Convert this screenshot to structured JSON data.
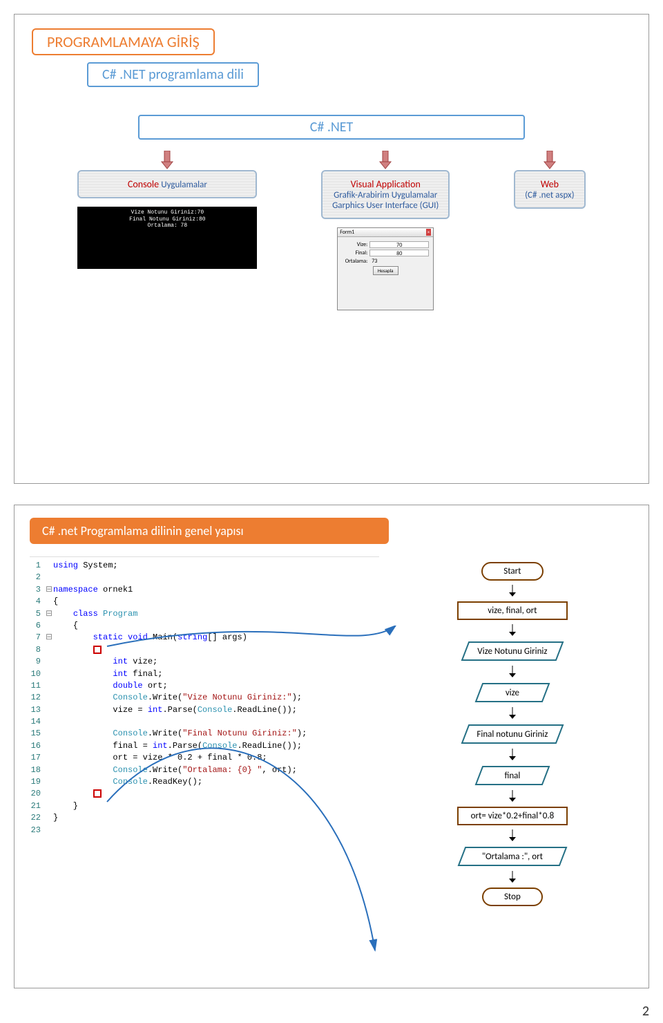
{
  "slide1": {
    "title": "PROGRAMLAMAYA GİRİŞ",
    "subtitle": "C# .NET    programlama dili",
    "center": "C# .NET",
    "boxes": {
      "console": {
        "line1": "Console",
        "line2": "Uygulamalar"
      },
      "visual": {
        "line1": "Visual   Application",
        "line2a": "Grafik-Arabirim Uygulamalar",
        "line2b": "Garphics User Interface (GUI)"
      },
      "web": {
        "line1": "Web",
        "line2": "(C# .net  aspx)"
      }
    },
    "consoleThumb": "Vize Notunu Giriniz:70\nFinal Notunu Giriniz:80\nOrtalama: 78",
    "formThumb": {
      "title": "Form1",
      "vize": "Vize:",
      "vizeVal": "70",
      "final": "Final:",
      "finalVal": "80",
      "ort": "Ortalama:",
      "ortVal": "73",
      "btn": "Hesapla"
    }
  },
  "slide2": {
    "title": "C# .net Programlama dilinin genel yapısı",
    "code": [
      {
        "n": "1",
        "g": "",
        "html": "<span class='kw'>using</span> System;"
      },
      {
        "n": "2",
        "g": "",
        "html": ""
      },
      {
        "n": "3",
        "g": "⊟",
        "html": "<span class='kw'>namespace</span> ornek1"
      },
      {
        "n": "4",
        "g": "",
        "html": "{"
      },
      {
        "n": "5",
        "g": "⊟",
        "html": "    <span class='kw'>class</span> <span class='ty'>Program</span>"
      },
      {
        "n": "6",
        "g": "",
        "html": "    {"
      },
      {
        "n": "7",
        "g": "⊟",
        "html": "        <span class='kw'>static</span> <span class='kw'>void</span> Main(<span class='kw'>string</span>[] args)"
      },
      {
        "n": "8",
        "g": "",
        "html": "        <span class='red-sq'></span>"
      },
      {
        "n": "9",
        "g": "",
        "html": "            <span class='kw'>int</span> vize;"
      },
      {
        "n": "10",
        "g": "",
        "html": "            <span class='kw'>int</span> final;"
      },
      {
        "n": "11",
        "g": "",
        "html": "            <span class='kw'>double</span> ort;"
      },
      {
        "n": "12",
        "g": "",
        "html": "            <span class='ty'>Console</span>.Write(<span class='str'>\"Vize Notunu Giriniz:\"</span>);"
      },
      {
        "n": "13",
        "g": "",
        "html": "            vize = <span class='kw'>int</span>.Parse(<span class='ty'>Console</span>.ReadLine());"
      },
      {
        "n": "14",
        "g": "",
        "html": ""
      },
      {
        "n": "15",
        "g": "",
        "html": "            <span class='ty'>Console</span>.Write(<span class='str'>\"Final Notunu Giriniz:\"</span>);"
      },
      {
        "n": "16",
        "g": "",
        "html": "            final = <span class='kw'>int</span>.Parse(<span class='ty'>Console</span>.ReadLine());"
      },
      {
        "n": "17",
        "g": "",
        "html": "            ort = vize * <span class='num'>0.2</span> + final * <span class='num'>0.8</span>;"
      },
      {
        "n": "18",
        "g": "",
        "html": "            <span class='ty'>Console</span>.Write(<span class='str'>\"Ortalama: {0} \"</span>, ort);"
      },
      {
        "n": "19",
        "g": "",
        "html": "            <span class='ty'>Console</span>.ReadKey();"
      },
      {
        "n": "20",
        "g": "",
        "html": "        <span class='red-sq'></span>"
      },
      {
        "n": "21",
        "g": "",
        "html": "    }"
      },
      {
        "n": "22",
        "g": "",
        "html": "}"
      },
      {
        "n": "23",
        "g": "",
        "html": ""
      }
    ],
    "flow": {
      "start": "Start",
      "decl": "vize,  final,  ort",
      "p1": "Vize Notunu Giriniz",
      "io1": "vize",
      "p2": "Final notunu Giriniz",
      "io2": "final",
      "calc": "ort= vize*0.2+final*0.8",
      "out": "\"Ortalama :\",    ort",
      "stop": "Stop"
    }
  },
  "pageNumber": "2"
}
